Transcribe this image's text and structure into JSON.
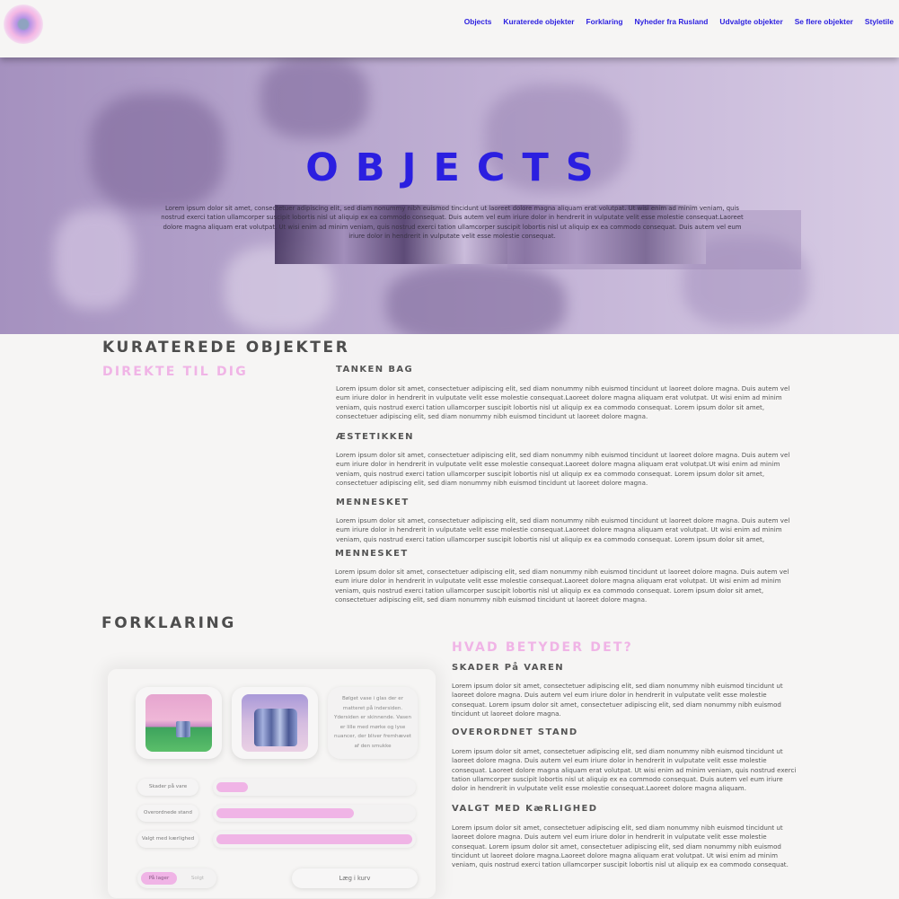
{
  "header": {
    "nav": [
      "Objects",
      "Kuraterede objekter",
      "Forklaring",
      "Nyheder fra Rusland",
      "Udvalgte objekter",
      "Se flere objekter",
      "Styletile"
    ]
  },
  "hero": {
    "title": "OBJECTS",
    "text": "Lorem ipsum dolor sit amet, consectetuer adipiscing elit, sed diam nonummy nibh euismod tincidunt ut laoreet dolore magna aliquam erat volutpat. Ut wisi enim ad minim veniam, quis nostrud exerci tation ullamcorper suscipit lobortis nisl ut aliquip ex ea commodo consequat. Duis autem vel eum iriure dolor in hendrerit in vulputate velit esse molestie consequat.Laoreet dolore magna aliquam erat volutpat. Ut wisi enim ad minim veniam, quis nostrud exerci tation ullamcorper suscipit lobortis nisl ut aliquip ex ea commodo consequat. Duis autem vel eum iriure dolor in hendrerit in vulputate velit esse molestie consequat."
  },
  "curated": {
    "title": "KURATEREDE OBJEKTER",
    "subtitle": "DIREKTE TIL DIG",
    "sections": [
      {
        "heading": "TANKEN BAG",
        "text": "Lorem ipsum dolor sit amet, consectetuer adipiscing elit, sed diam nonummy nibh euismod tincidunt ut laoreet dolore magna. Duis autem vel eum iriure dolor in hendrerit in vulputate velit esse molestie consequat.Laoreet dolore magna aliquam erat volutpat. Ut wisi enim ad minim veniam, quis nostrud exerci tation ullamcorper suscipit lobortis nisl ut aliquip ex ea commodo consequat. Lorem ipsum dolor sit amet, consectetuer adipiscing elit, sed diam nonummy nibh euismod tincidunt ut laoreet dolore magna."
      },
      {
        "heading": "ÆSTETIKKEN",
        "text": "Lorem ipsum dolor sit amet, consectetuer adipiscing elit, sed diam nonummy nibh euismod tincidunt ut laoreet dolore magna. Duis autem vel eum iriure dolor in hendrerit in vulputate velit esse molestie consequat.Laoreet dolore magna aliquam erat volutpat.Ut wisi enim ad minim veniam, quis nostrud exerci tation ullamcorper suscipit lobortis nisl ut aliquip ex ea commodo consequat. Lorem ipsum dolor sit amet, consectetuer adipiscing elit, sed diam nonummy nibh euismod tincidunt ut laoreet dolore magna."
      },
      {
        "heading": "MENNESKET",
        "text": "Lorem ipsum dolor sit amet, consectetuer adipiscing elit, sed diam nonummy nibh euismod tincidunt ut laoreet dolore magna. Duis autem vel eum iriure dolor in hendrerit in vulputate velit esse molestie consequat.Laoreet dolore magna aliquam erat volutpat. Ut wisi enim ad minim veniam, quis nostrud exerci tation ullamcorper suscipit lobortis nisl ut aliquip ex ea commodo consequat. Lorem ipsum dolor sit amet, consectetuer adipiscing elit, sed diam nonummy nibh euismod tincidunt ut laoreet dolore magna."
      },
      {
        "heading": "MENNESKET",
        "text": "Lorem ipsum dolor sit amet, consectetuer adipiscing elit, sed diam nonummy nibh euismod tincidunt ut laoreet dolore magna. Duis autem vel eum iriure dolor in hendrerit in vulputate velit esse molestie consequat.Laoreet dolore magna aliquam erat volutpat. Ut wisi enim ad minim veniam, quis nostrud exerci tation ullamcorper suscipit lobortis nisl ut aliquip ex ea commodo consequat. Lorem ipsum dolor sit amet, consectetuer adipiscing elit, sed diam nonummy nibh euismod tincidunt ut laoreet dolore magna."
      }
    ]
  },
  "explanation": {
    "title": "FORKLARING",
    "question": "HVAD BETYDER DET?",
    "sections": [
      {
        "heading": "SKADER På VAREN",
        "text": "Lorem ipsum dolor sit amet, consectetuer adipiscing elit, sed diam nonummy nibh euismod tincidunt ut laoreet dolore magna. Duis autem vel eum iriure dolor in hendrerit in vulputate velit esse molestie consequat. Lorem ipsum dolor sit amet, consectetuer adipiscing elit, sed diam nonummy nibh euismod tincidunt ut laoreet dolore magna."
      },
      {
        "heading": "OVERORDNET STAND",
        "text": "Lorem ipsum dolor sit amet, consectetuer adipiscing elit, sed diam nonummy nibh euismod tincidunt ut laoreet dolore magna. Duis autem vel eum iriure dolor in hendrerit in vulputate velit esse molestie consequat. Laoreet dolore magna aliquam erat volutpat. Ut wisi enim ad minim veniam, quis nostrud exerci tation ullamcorper suscipit lobortis nisl ut aliquip ex ea commodo consequat. Duis autem vel eum iriure dolor in hendrerit in vulputate velit esse molestie consequat.Laoreet dolore magna aliquam."
      },
      {
        "heading": "VALGT MED KæRLIGHED",
        "text": "Lorem ipsum dolor sit amet, consectetuer adipiscing elit, sed diam nonummy nibh euismod tincidunt ut laoreet dolore magna. Duis autem vel eum iriure dolor in hendrerit in vulputate velit esse molestie consequat. Lorem ipsum dolor sit amet, consectetuer adipiscing elit, sed diam nonummy nibh euismod tincidunt ut laoreet dolore magna.Laoreet dolore magna aliquam erat volutpat. Ut wisi enim ad minim veniam, quis nostrud exerci tation ullamcorper suscipit lobortis nisl ut aliquip ex ea commodo consequat."
      }
    ]
  },
  "product_card": {
    "description": "Bølget vase i glas der er matteret på indersiden. Ydersiden er skinnende. Vasen er lille med mørke og lyse nuancer, der bliver fremhævet af den smukke",
    "ratings": [
      {
        "label": "Skader på vare",
        "level": 0.16
      },
      {
        "label": "Overordnede stand",
        "level": 0.7
      },
      {
        "label": "Valgt med kærlighed",
        "level": 1.0
      }
    ],
    "stock_on": "På lager",
    "stock_off": "Solgt",
    "cart_button": "Læg i kurv"
  },
  "colors": {
    "accent_blue": "#2b1fe0",
    "pink": "#f0b4e6",
    "heading_gray": "#4d4d4d",
    "background": "#f6f5f4"
  }
}
